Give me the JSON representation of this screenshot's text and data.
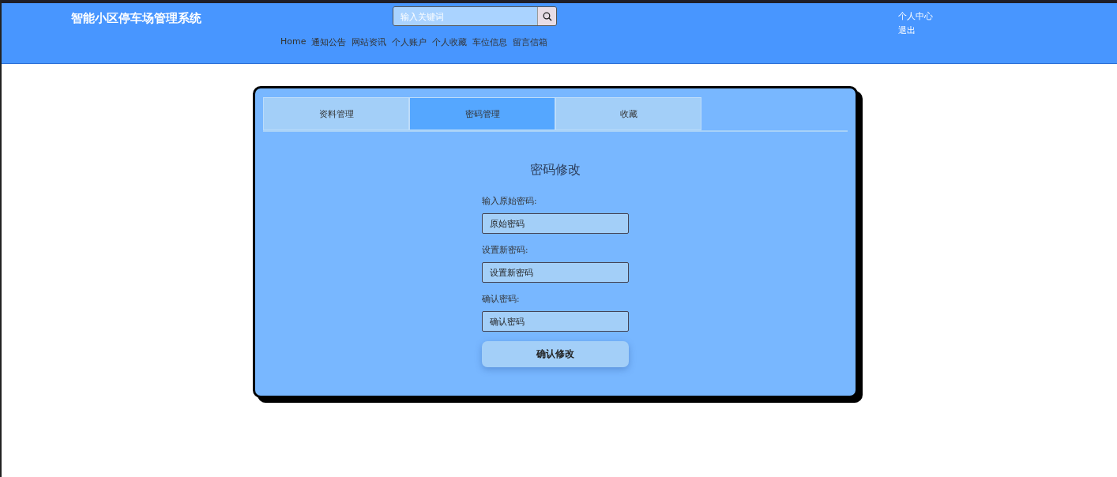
{
  "header": {
    "title": "智能小区停车场管理系统",
    "search": {
      "placeholder": "输入关键词"
    },
    "nav": [
      {
        "label": "Home"
      },
      {
        "label": "通知公告"
      },
      {
        "label": "网站资讯"
      },
      {
        "label": "个人账户"
      },
      {
        "label": "个人收藏"
      },
      {
        "label": "车位信息"
      },
      {
        "label": "留言信箱"
      }
    ],
    "user_links": [
      {
        "label": "个人中心"
      },
      {
        "label": "退出"
      }
    ]
  },
  "tabs": [
    {
      "label": "资料管理",
      "selected": false
    },
    {
      "label": "密码管理",
      "selected": true
    },
    {
      "label": "收藏",
      "selected": false
    }
  ],
  "form": {
    "title": "密码修改",
    "fields": [
      {
        "label": "输入原始密码:",
        "placeholder": "原始密码"
      },
      {
        "label": "设置新密码:",
        "placeholder": "设置新密码"
      },
      {
        "label": "确认密码:",
        "placeholder": "确认密码"
      }
    ],
    "submit": "确认修改"
  }
}
